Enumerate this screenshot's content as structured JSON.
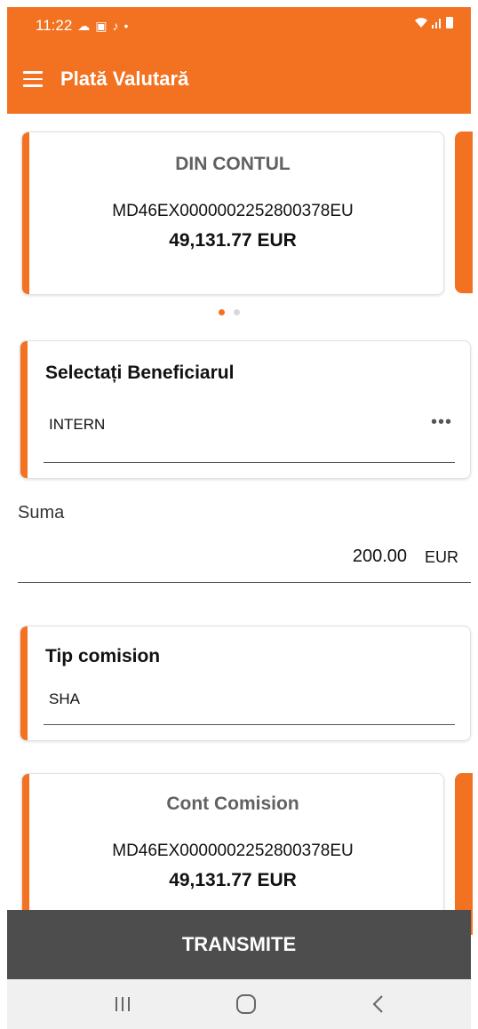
{
  "status_bar": {
    "time": "11:22",
    "notification_icons": [
      "weather-icon",
      "gallery-icon",
      "tiktok-icon",
      "dot-icon"
    ],
    "right_icons": [
      "wifi-icon",
      "signal-icon",
      "battery-icon"
    ]
  },
  "app_bar": {
    "title": "Plată Valutară",
    "menu_icon": "hamburger-menu-icon"
  },
  "from_account": {
    "header": "DIN CONTUL",
    "account_number": "MD46EX0000002252800378EU",
    "balance": "49,131.77 EUR"
  },
  "pager": {
    "count": 2,
    "active_index": 0
  },
  "beneficiary": {
    "title": "Selectați Beneficiarul",
    "value": "INTERN",
    "more_icon": "more-horizontal-icon"
  },
  "amount": {
    "label": "Suma",
    "value": "200.00",
    "currency": "EUR"
  },
  "commission_type": {
    "title": "Tip comision",
    "value": "SHA"
  },
  "commission_account": {
    "header": "Cont Comision",
    "account_number": "MD46EX0000002252800378EU",
    "balance": "49,131.77 EUR"
  },
  "submit": {
    "label": "TRANSMITE"
  },
  "nav_bar": {
    "items": [
      "recents-icon",
      "home-icon",
      "back-icon"
    ]
  },
  "colors": {
    "accent": "#f27221",
    "button_bg": "#4d4d4d",
    "nav_bg": "#f0f0f0"
  }
}
